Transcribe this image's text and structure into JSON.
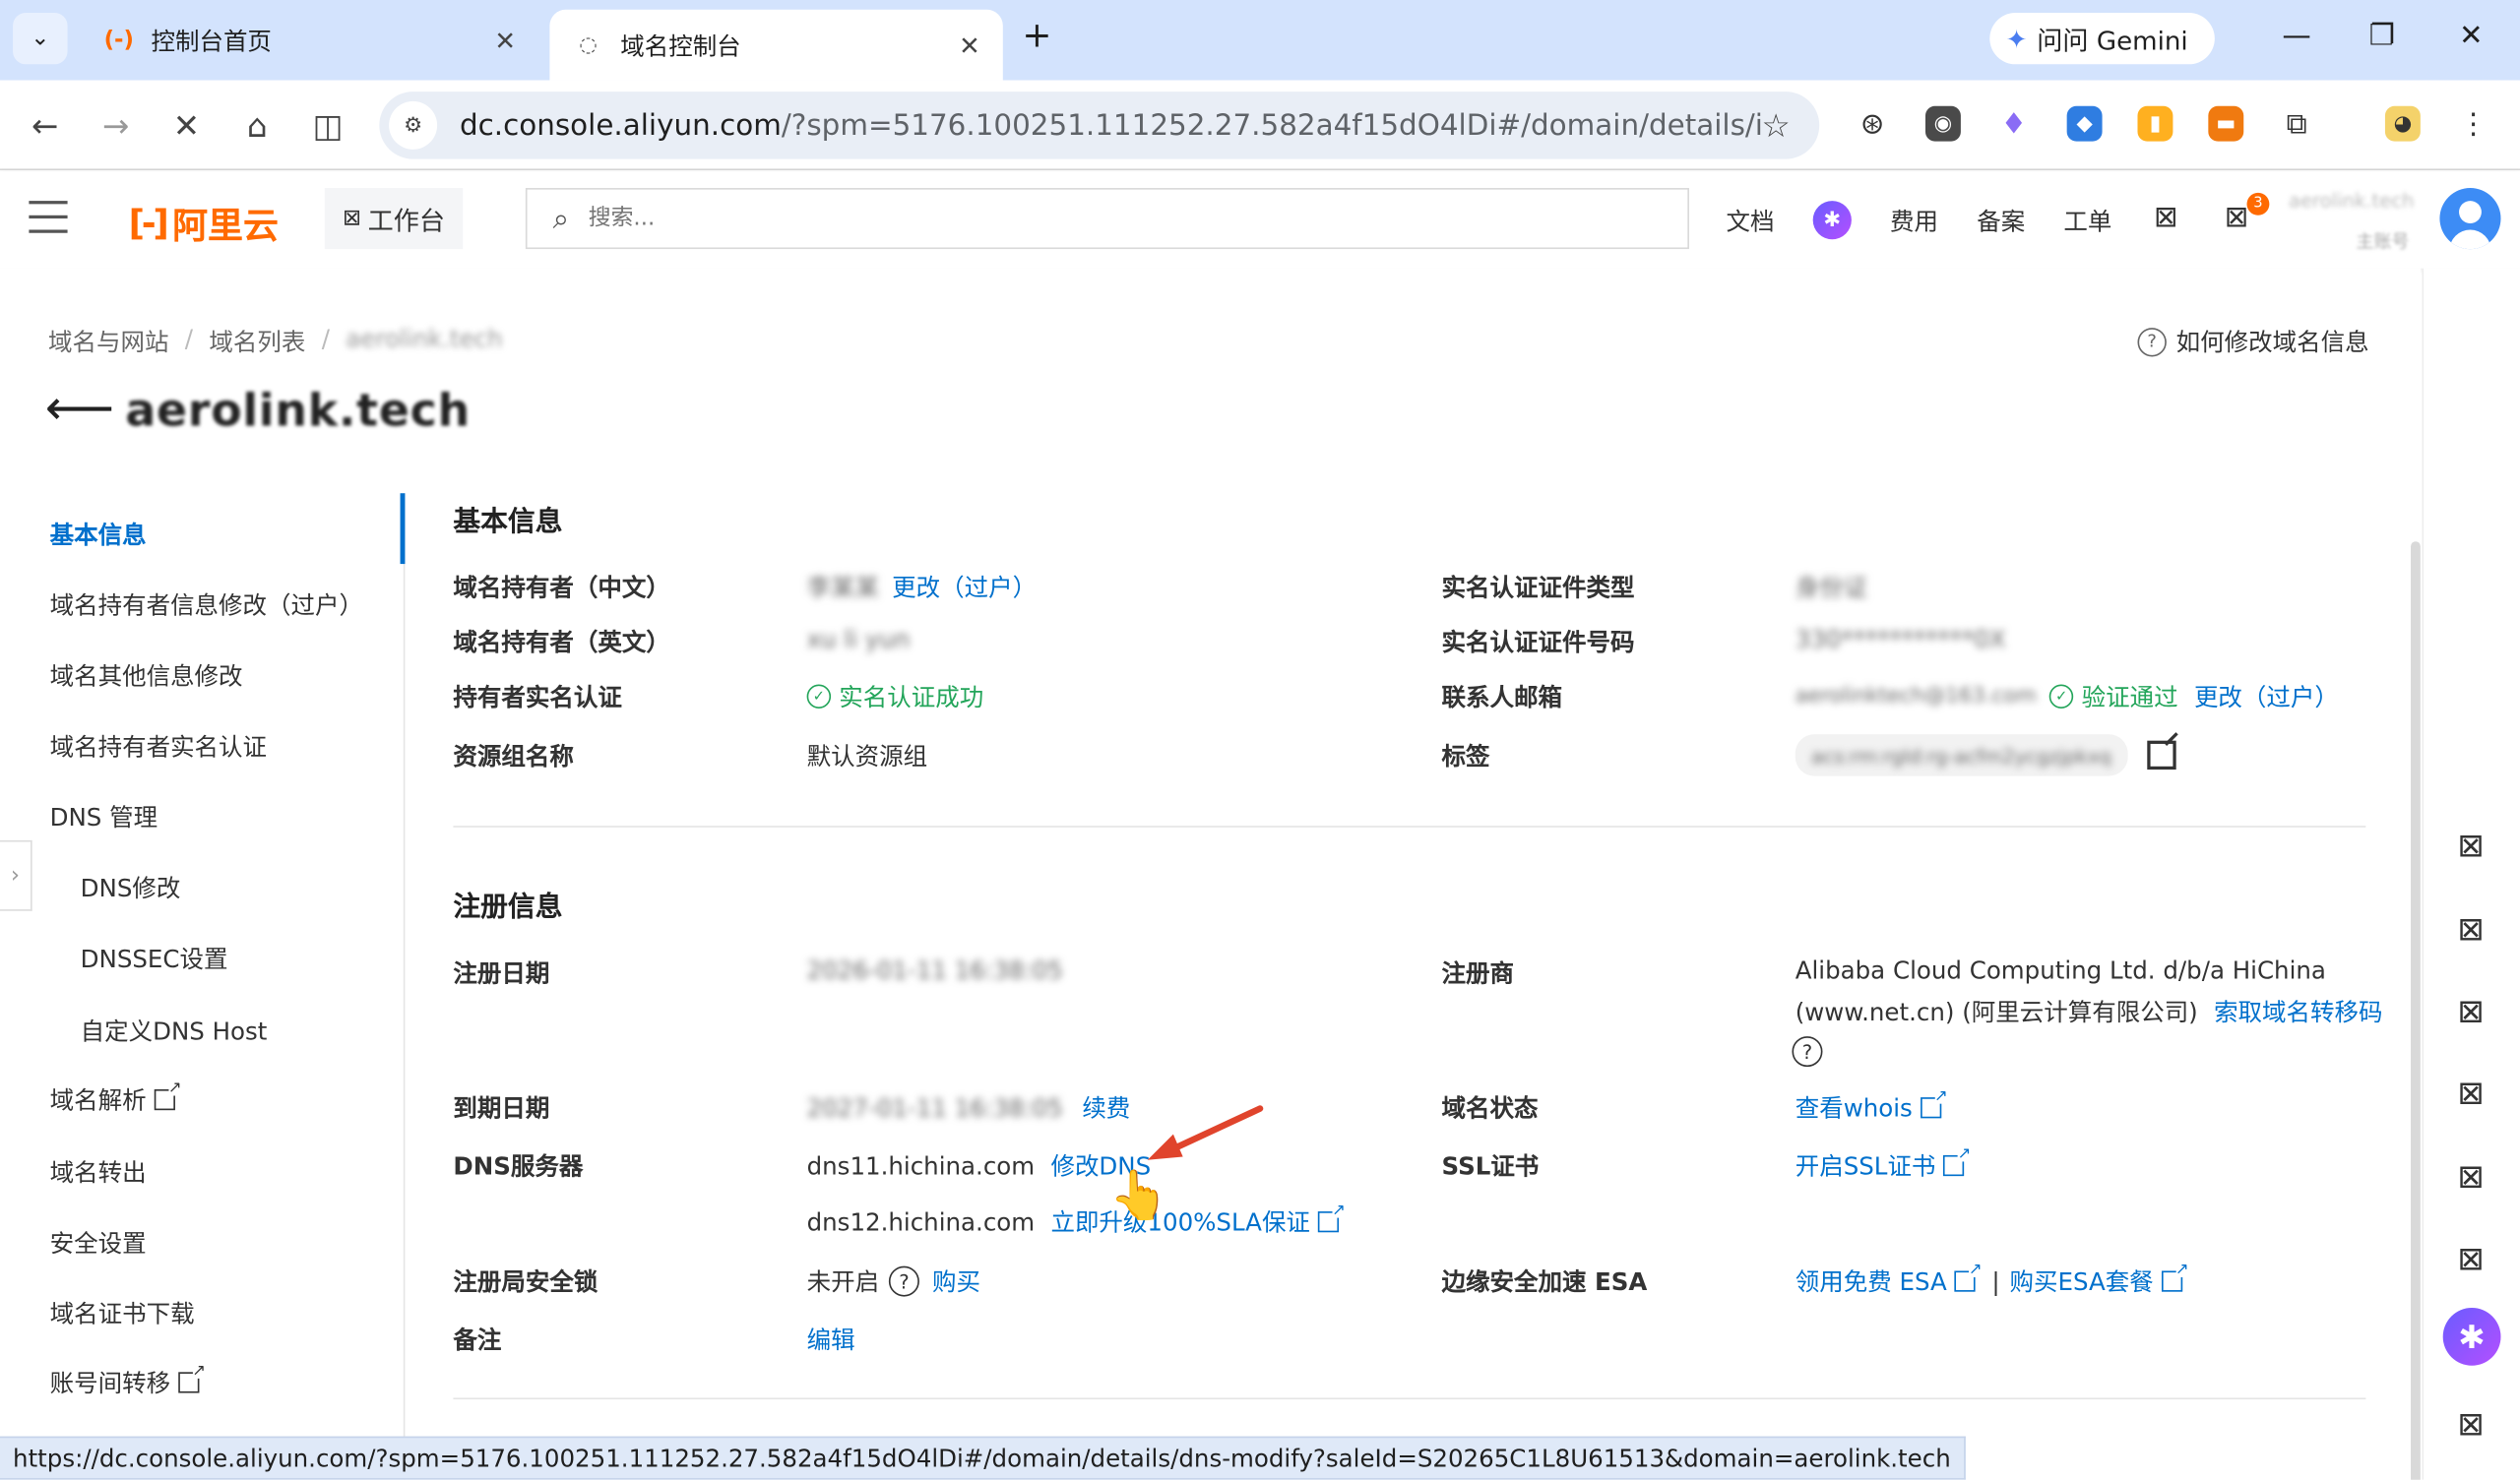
{
  "browser": {
    "tabs": [
      {
        "title": "控制台首页",
        "active": false
      },
      {
        "title": "域名控制台",
        "active": true
      }
    ],
    "gemini_label": "问问 Gemini",
    "url_host": "dc.console.aliyun.com",
    "url_rest": "/?spm=5176.100251.111252.27.582a4f15dO4lDi#/domain/details/info?sa...",
    "status_url": "https://dc.console.aliyun.com/?spm=5176.100251.111252.27.582a4f15dO4lDi#/domain/details/dns-modify?saleId=S20265C1L8U61513&domain=aerolink.tech"
  },
  "topnav": {
    "logo": "阿里云",
    "workbench": "工作台",
    "search_placeholder": "搜索...",
    "links": [
      "文档",
      "费用",
      "备案",
      "工单"
    ],
    "notif_count": "3",
    "account_name": "aerolink.tech",
    "account_sub": "主账号"
  },
  "page": {
    "breadcrumb": [
      "域名与网站",
      "域名列表",
      "aerolink.tech"
    ],
    "help": "如何修改域名信息",
    "title": "aerolink.tech"
  },
  "sidenav": {
    "items": [
      {
        "label": "基本信息",
        "active": true
      },
      {
        "label": "域名持有者信息修改（过户）"
      },
      {
        "label": "域名其他信息修改"
      },
      {
        "label": "域名持有者实名认证"
      },
      {
        "label": "DNS 管理"
      },
      {
        "label": "DNS修改"
      },
      {
        "label": "DNSSEC设置"
      },
      {
        "label": "自定义DNS Host"
      },
      {
        "label": "域名解析"
      },
      {
        "label": "域名转出"
      },
      {
        "label": "安全设置"
      },
      {
        "label": "域名证书下载"
      },
      {
        "label": "账号间转移"
      }
    ]
  },
  "basic": {
    "title": "基本信息",
    "holder_cn_label": "域名持有者（中文）",
    "holder_cn_value": "李某某",
    "holder_cn_action": "更改（过户）",
    "holder_en_label": "域名持有者（英文）",
    "holder_en_value": "xu li yun",
    "verify_label": "持有者实名认证",
    "verify_value": "实名认证成功",
    "group_label": "资源组名称",
    "group_value": "默认资源组",
    "cert_type_label": "实名认证证件类型",
    "cert_type_value": "身份证",
    "cert_no_label": "实名认证证件号码",
    "cert_no_value": "330***********0X",
    "email_label": "联系人邮箱",
    "email_value": "aerolinktech@163.com",
    "email_status": "验证通过",
    "email_action": "更改（过户）",
    "tag_label": "标签",
    "tag_value": "acs:rm:rgId:rg-acfm2ycgzjpkxq"
  },
  "reg": {
    "title": "注册信息",
    "reg_date_label": "注册日期",
    "reg_date_value": "2026-01-11 16:38:05",
    "expire_label": "到期日期",
    "expire_value": "2027-01-11 16:38:05",
    "renew": "续费",
    "dns_label": "DNS服务器",
    "dns1": "dns11.hichina.com",
    "dns_modify": "修改DNS",
    "dns2": "dns12.hichina.com",
    "sla": "立即升级100%SLA保证",
    "lock_label": "注册局安全锁",
    "lock_value": "未开启",
    "lock_buy": "购买",
    "note_label": "备注",
    "note_edit": "编辑",
    "registrar_label": "注册商",
    "registrar_line1": "Alibaba Cloud Computing Ltd. d/b/a HiChina",
    "registrar_line2": "(www.net.cn) (阿里云计算有限公司)",
    "transfer_code": "索取域名转移码",
    "status_label": "域名状态",
    "whois": "查看whois",
    "ssl_label": "SSL证书",
    "ssl_action": "开启SSL证书",
    "esa_label": "边缘安全加速 ESA",
    "esa_free": "领用免费 ESA",
    "esa_sep": "|",
    "esa_buy": "购买ESA套餐"
  },
  "colors": {
    "link": "#0070cc",
    "success": "#23a55a",
    "brand": "#ff6a00"
  }
}
